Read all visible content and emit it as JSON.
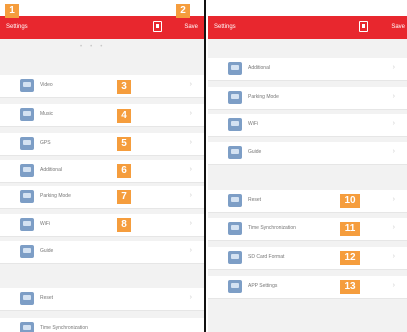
{
  "left": {
    "title": "Settings",
    "save": "Save",
    "items": [
      {
        "label": "Video",
        "icon": "video-icon",
        "badge": "3"
      },
      {
        "label": "Music",
        "icon": "music-icon",
        "badge": "4"
      },
      {
        "label": "GPS",
        "icon": "gps-icon",
        "badge": "5"
      },
      {
        "label": "Additional",
        "icon": "additional-icon",
        "badge": "6"
      },
      {
        "label": "Parking Mode",
        "icon": "parking-mode-icon",
        "badge": "7"
      },
      {
        "label": "WiFi",
        "icon": "wifi-icon",
        "badge": "8"
      },
      {
        "label": "Guide",
        "icon": "guide-icon",
        "badge": ""
      },
      {
        "label": "Reset",
        "icon": "reset-icon",
        "badge": ""
      },
      {
        "label": "Time Synchronization",
        "icon": "time-sync-icon",
        "badge": ""
      }
    ]
  },
  "right": {
    "title": "Settings",
    "save": "Save",
    "items": [
      {
        "label": "Additional",
        "icon": "additional-icon",
        "badge": ""
      },
      {
        "label": "Parking Mode",
        "icon": "parking-mode-icon",
        "badge": ""
      },
      {
        "label": "WiFi",
        "icon": "wifi-icon",
        "badge": ""
      },
      {
        "label": "Guide",
        "icon": "guide-icon",
        "badge": ""
      },
      {
        "label": "Reset",
        "icon": "reset-icon",
        "badge": "10"
      },
      {
        "label": "Time Synchronization",
        "icon": "time-sync-icon",
        "badge": "11"
      },
      {
        "label": "SD Card Format",
        "icon": "sd-card-icon",
        "badge": "12"
      },
      {
        "label": "APP Settings",
        "icon": "app-settings-icon",
        "badge": "13"
      }
    ]
  },
  "callouts": {
    "settings": "1",
    "save": "2"
  },
  "colors": {
    "header": "#e8272e",
    "badge": "#f59d3d",
    "icon": "#7d9ec6"
  }
}
